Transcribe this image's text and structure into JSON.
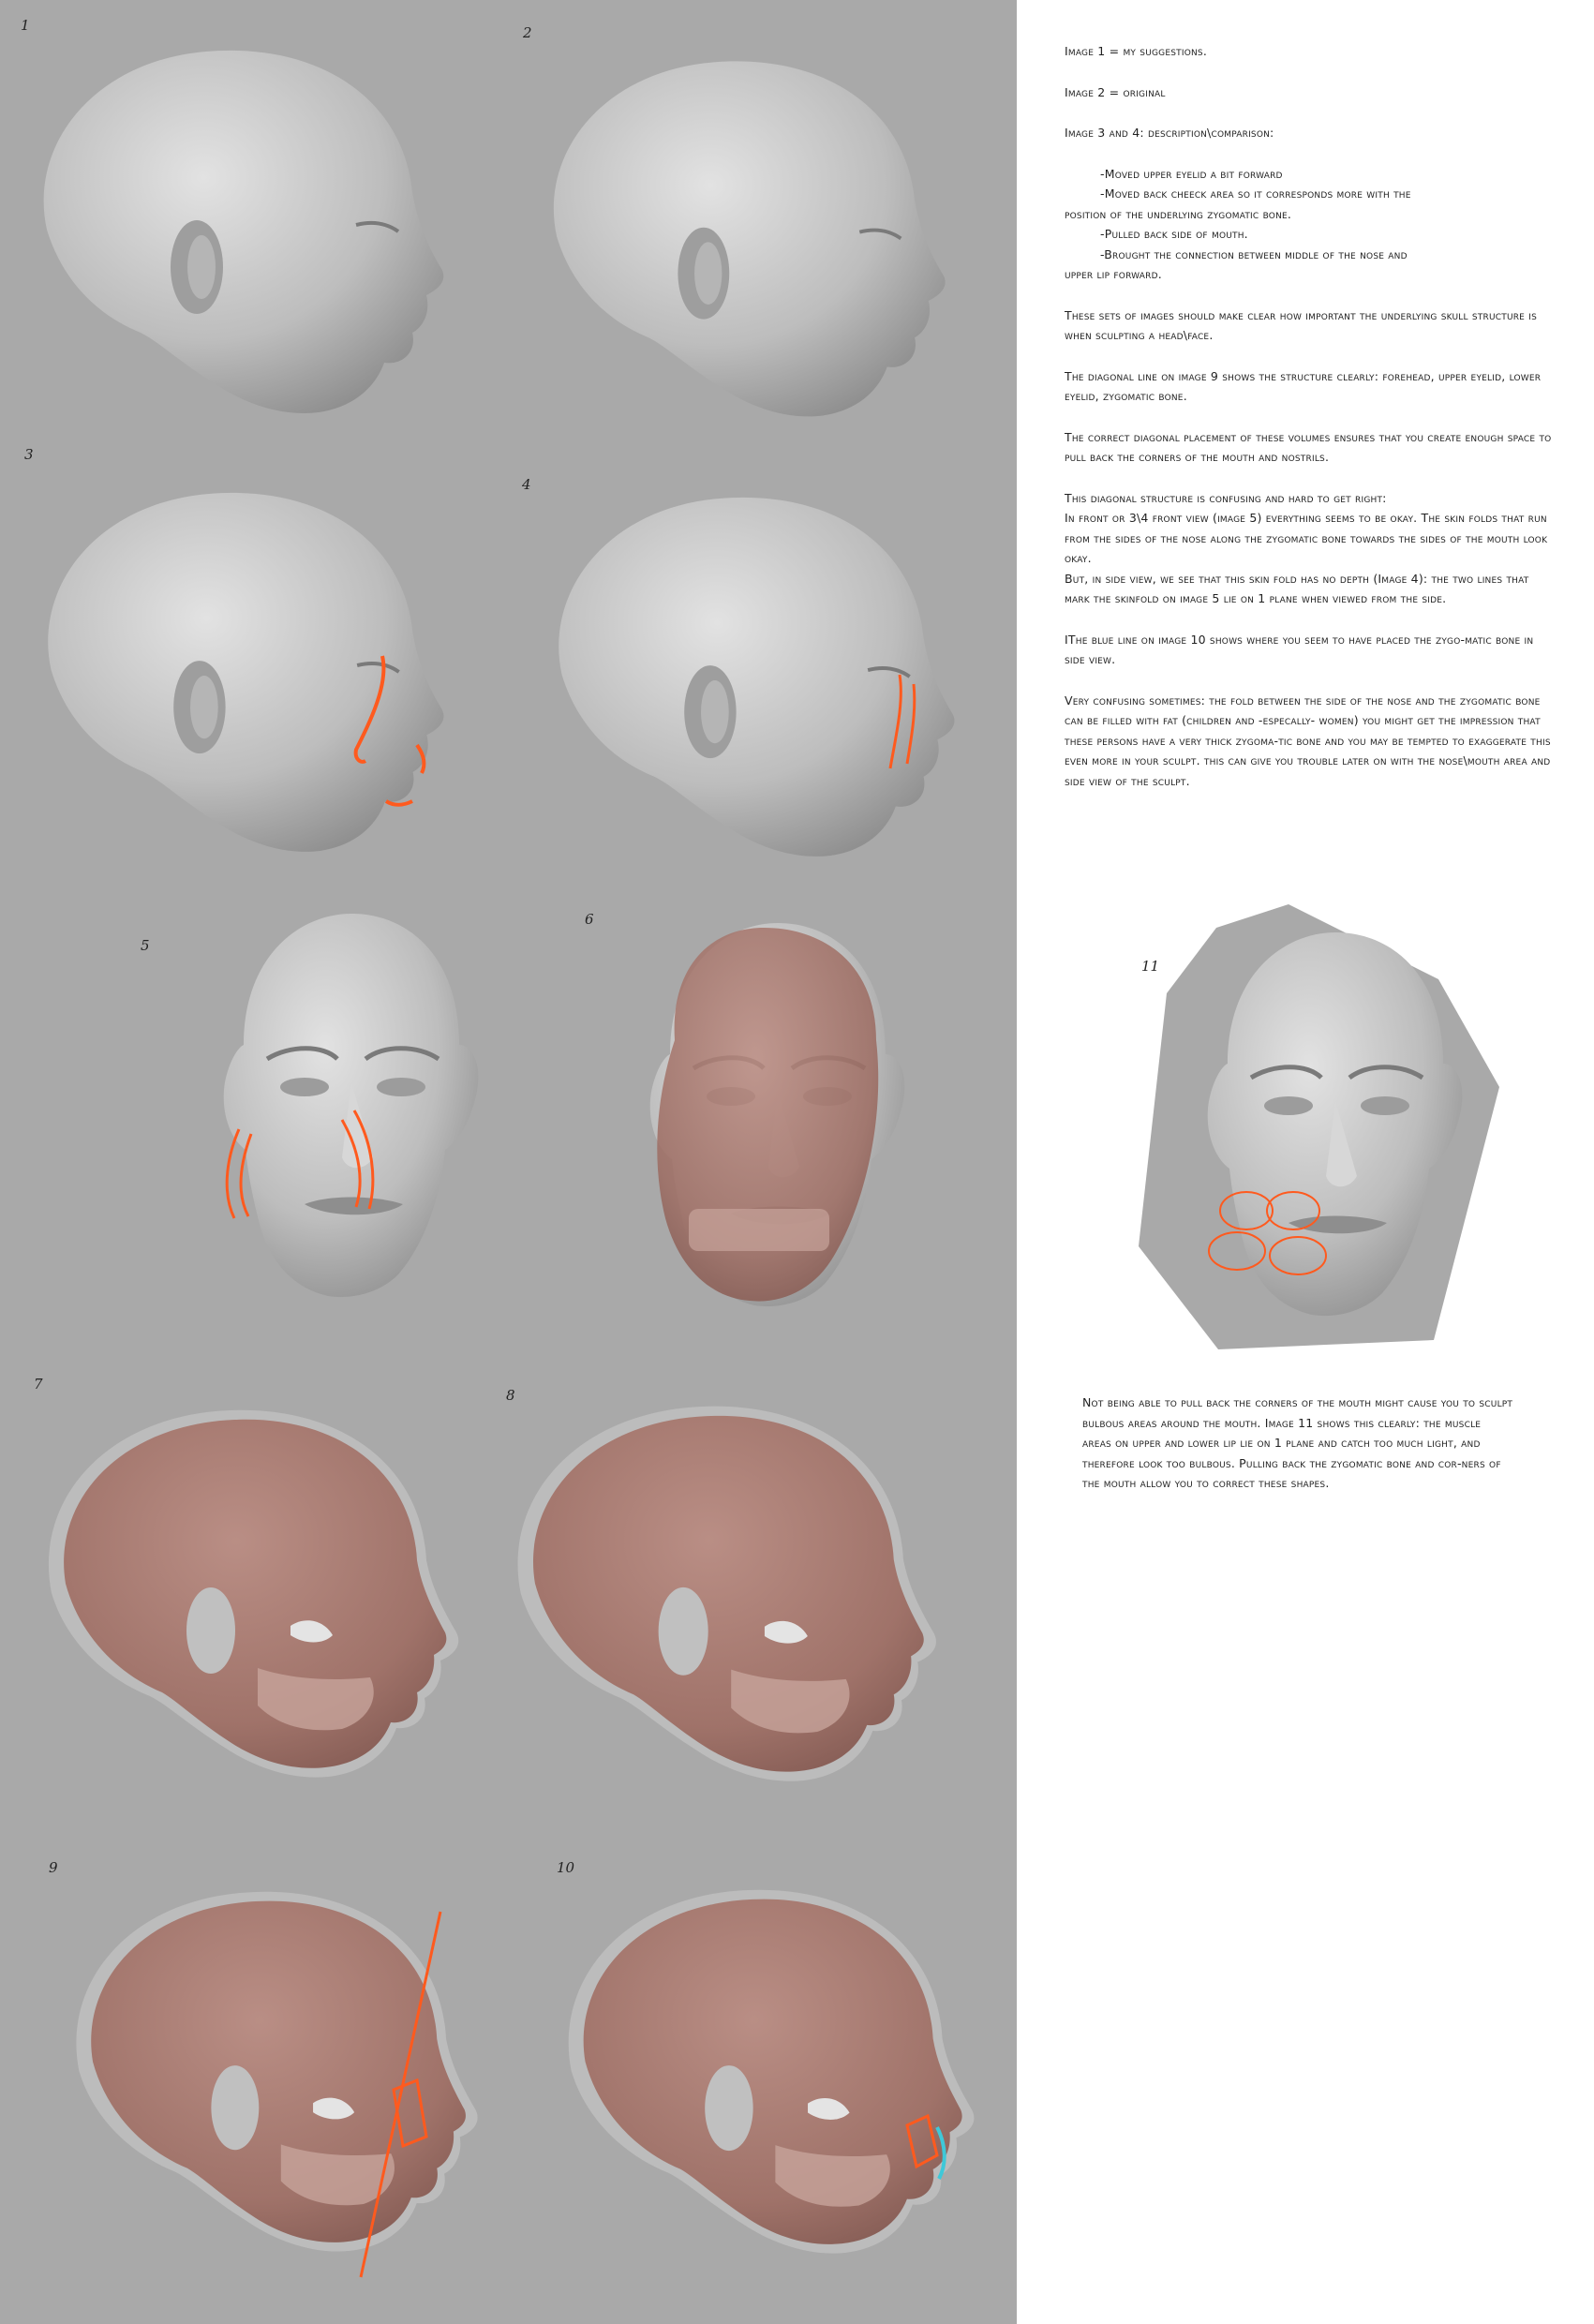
{
  "panels": [
    {
      "num": "1"
    },
    {
      "num": "2"
    },
    {
      "num": "3"
    },
    {
      "num": "4"
    },
    {
      "num": "5"
    },
    {
      "num": "6"
    },
    {
      "num": "7"
    },
    {
      "num": "8"
    },
    {
      "num": "9"
    },
    {
      "num": "10"
    },
    {
      "num": "11"
    }
  ],
  "notes": {
    "image1": "Image 1 = my suggestions.",
    "image2": "Image 2 = original",
    "image34": "Image 3 and 4: description\\comparison:",
    "list": [
      "-Moved upper eyelid a bit forward",
      "-Moved back cheeck area so it corresponds more with the",
      "position of the underlying zygomatic bone.",
      "-Pulled back side of mouth.",
      "-Brought the connection between middle of the nose and",
      "upper lip forward."
    ],
    "p_skull": "These sets of images should make clear how important the underlying skull structure is when sculpting a head\\face.",
    "p_diagonal": "The diagonal line on image 9 shows the structure clearly: forehead, upper eyelid, lower eyelid, zygomatic bone.",
    "p_correct": "The correct diagonal placement of these volumes ensures that you create enough space to pull back the corners of the mouth and nostrils.",
    "p_confusing_l1": "This diagonal structure is confusing and hard to get right:",
    "p_confusing_l2": "In front or 3\\4 front view (image 5) everything seems to be okay. The skin folds that run from the sides of the nose along the zygomatic bone towards the sides of the mouth look okay.",
    "p_confusing_l3": "But, in side view, we see that this skin fold has no depth (Image 4): the two lines that mark the skinfold on image 5 lie on 1 plane when viewed from the side.",
    "p_blue": "IThe blue line on image 10 shows where you seem to have placed the zygo-matic bone in side view.",
    "p_very": "Very confusing sometimes: the fold between the side of the nose and the zygomatic bone can be filled with fat (children and -especally- women) you might get the impression that these persons have a very thick zygoma-tic bone and you may be tempted to exaggerate this even more in your sculpt. this can give you trouble later on with the nose\\mouth area and side view of the sculpt.",
    "p_bulbous": "Not being able to pull back the corners of the mouth might cause you to sculpt bulbous areas around the mouth. Image 11 shows this clearly: the muscle areas on upper and lower lip lie on 1 plane and catch too much light, and therefore look too bulbous. Pulling back the zygomatic bone and cor-ners of the mouth allow you to correct these shapes."
  },
  "colors": {
    "panel_bg": "#a9a9a9",
    "clay": "#c6c6c6",
    "skin_overlay": "#a06a5e",
    "orange_line": "#ff5a1e",
    "blue_line": "#3fc8d8"
  }
}
